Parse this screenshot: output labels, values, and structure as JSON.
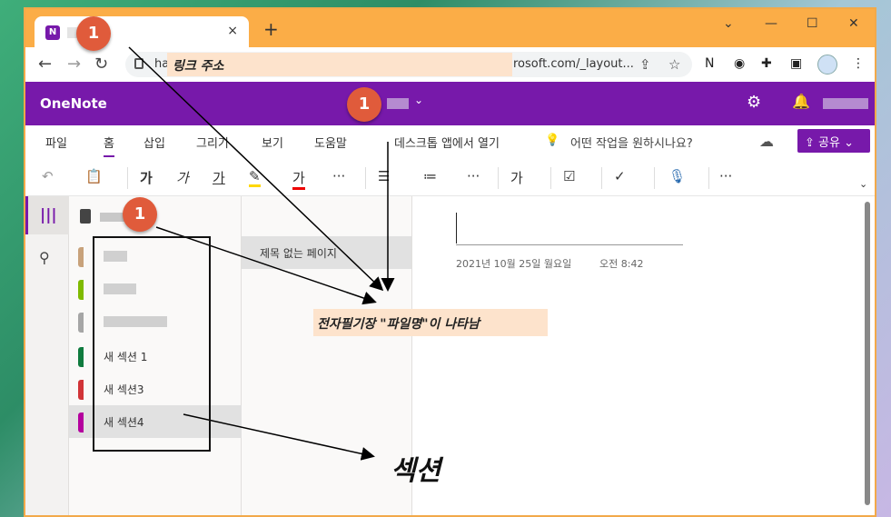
{
  "browser": {
    "tab_close": "×",
    "new_tab": "+",
    "window_controls": [
      "⌄",
      "—",
      "☐",
      "✕"
    ],
    "url_left": "ha",
    "url_right": "rosoft.com/_layout...",
    "address_annotation": "링크 주소"
  },
  "onenote": {
    "brand": "OneNote",
    "notebook_chevron": "⌄"
  },
  "ribbon": {
    "tabs": [
      "파일",
      "홈",
      "삽입",
      "그리기",
      "보기",
      "도움말"
    ],
    "open_desktop": "데스크톱 앱에서 열기",
    "tell_me": "어떤 작업을 원하시나요?",
    "share": "공유"
  },
  "toolbar": {
    "undo": "↶",
    "paste": "📋",
    "bold": "가",
    "italic": "가",
    "underline": "가",
    "font_color": "가",
    "more": "···"
  },
  "sections": {
    "items": [
      {
        "label": "",
        "color": "#c8a27b"
      },
      {
        "label": "",
        "color": "#7fba00"
      },
      {
        "label": "",
        "color": "#a6a6a6"
      },
      {
        "label": "새 섹션 1",
        "color": "#0f7b3e"
      },
      {
        "label": "새 섹션3",
        "color": "#d13438"
      },
      {
        "label": "새 섹션4",
        "color": "#b4009e"
      }
    ]
  },
  "pages": {
    "items": [
      "제목 없는 페이지"
    ]
  },
  "page": {
    "date": "2021년 10월 25일 월요일",
    "time": "오전 8:42"
  },
  "annotations": {
    "badge_number": "1",
    "file_name_note": "전자필기장 \"파일명\"이 나타남",
    "section_note": "섹션"
  }
}
